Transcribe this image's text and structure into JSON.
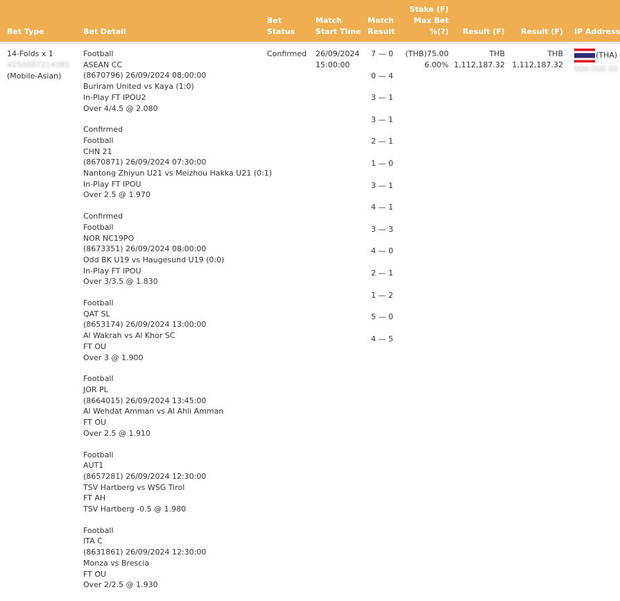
{
  "header": {
    "bet_type": "Bet Type",
    "bet_detail": "Bet Detail",
    "bet_status_l1": "Bet",
    "bet_status_l2": "Status",
    "match_start_l1": "Match",
    "match_start_l2": "Start Time",
    "match_result_l1": "Match",
    "match_result_l2": "Result",
    "stake_l1": "Stake (F)",
    "stake_l2": "Max Bet",
    "stake_l3": "%(?)",
    "result1": "Result (F)",
    "result2": "Result (F)",
    "ip_address": "IP Address"
  },
  "bet": {
    "type": "14-Folds x 1",
    "ref": "4255087214381",
    "channel": "(Mobile-Asian)",
    "status": "Confirmed",
    "start_date": "26/09/2024",
    "start_time": "15:00:00",
    "stake": "(THB)75.00",
    "max_bet_pct": "6.00%",
    "result1_currency": "THB",
    "result1_amount": "1,112,187.32",
    "result2_currency": "THB",
    "result2_amount": "1,112,187.32",
    "ip_country": "(THA)",
    "ip_value": "000.000.000.000"
  },
  "results": [
    "7 — 0",
    "0 — 4",
    "3 — 1",
    "3 — 1",
    "2 — 1",
    "1 — 0",
    "3 — 1",
    "4 — 1",
    "3 — 3",
    "4 — 0",
    "2 — 1",
    "1 — 2",
    "5 — 0",
    "4 — 5"
  ],
  "legs": [
    {
      "status": "",
      "sport": "Football",
      "league": "ASEAN CC",
      "match_id": "(8670796) 26/09/2024 08:00:00",
      "teams": "Buriram United vs Kaya (1:0)",
      "market": "In-Play FT IPOU2",
      "selection": "Over 4/4.5 @ 2.080"
    },
    {
      "status": "Confirmed",
      "sport": "Football",
      "league": "CHN 21",
      "match_id": "(8670871) 26/09/2024 07:30:00",
      "teams": "Nantong Zhiyun U21 vs Meizhou Hakka U21 (0:1)",
      "market": "In-Play FT IPOU",
      "selection": "Over 2.5 @ 1.970"
    },
    {
      "status": "Confirmed",
      "sport": "Football",
      "league": "NOR NC19PO",
      "match_id": "(8673351) 26/09/2024 08:00:00",
      "teams": "Odd BK U19 vs Haugesund U19 (0:0)",
      "market": "In-Play FT IPOU",
      "selection": "Over 3/3.5 @ 1.830"
    },
    {
      "status": "",
      "sport": "Football",
      "league": "QAT SL",
      "match_id": "(8653174) 26/09/2024 13:00:00",
      "teams": "Al Wakrah vs Al Khor SC",
      "market": "FT OU",
      "selection": "Over 3 @ 1.900"
    },
    {
      "status": "",
      "sport": "Football",
      "league": "JOR PL",
      "match_id": "(8664015) 26/09/2024 13:45:00",
      "teams": "Al Wehdat Amman vs Al Ahli Amman",
      "market": "FT OU",
      "selection": "Over 2.5 @ 1.910"
    },
    {
      "status": "",
      "sport": "Football",
      "league": "AUT1",
      "match_id": "(8657281) 26/09/2024 12:30:00",
      "teams": "TSV Hartberg vs WSG Tirol",
      "market": "FT AH",
      "selection": "TSV Hartberg -0.5 @ 1.980"
    },
    {
      "status": "",
      "sport": "Football",
      "league": "ITA C",
      "match_id": "(8631861) 26/09/2024 12:30:00",
      "teams": "Monza vs Brescia",
      "market": "FT OU",
      "selection": "Over 2/2.5 @ 1.930"
    }
  ]
}
